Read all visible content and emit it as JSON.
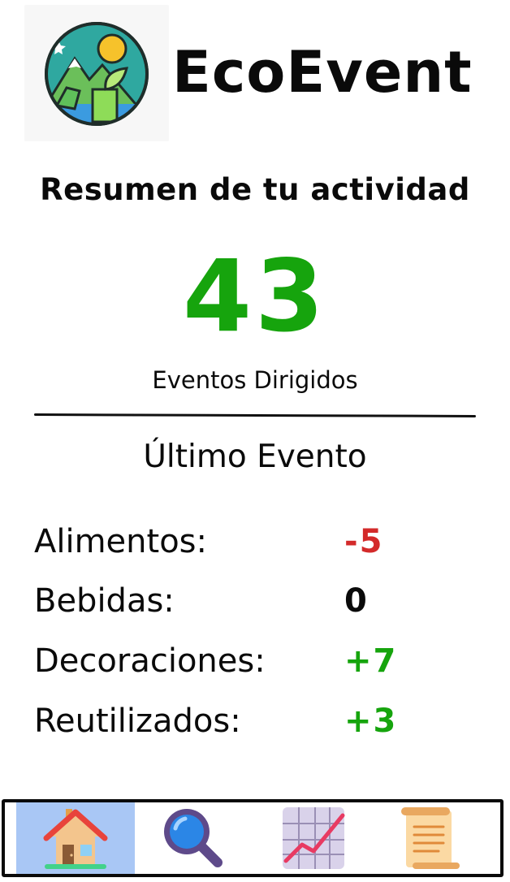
{
  "app": {
    "name": "EcoEvent",
    "logo_icon": "eco-landscape-logo"
  },
  "summary": {
    "title": "Resumen de tu actividad",
    "events_led_count": "43",
    "events_led_label": "Eventos Dirigidos",
    "count_color": "#16a40d"
  },
  "last_event": {
    "title": "Último Evento",
    "stats": [
      {
        "label": "Alimentos:",
        "value": "-5",
        "color": "#d32a2a"
      },
      {
        "label": "Bebidas:",
        "value": "0",
        "color": "#0a0a0a"
      },
      {
        "label": "Decoraciones:",
        "value": "+7",
        "color": "#16a40d"
      },
      {
        "label": "Reutilizados:",
        "value": "+3",
        "color": "#16a40d"
      }
    ]
  },
  "nav": {
    "items": [
      {
        "icon": "home-icon",
        "active": true
      },
      {
        "icon": "search-icon",
        "active": false
      },
      {
        "icon": "chart-icon",
        "active": false
      },
      {
        "icon": "scroll-icon",
        "active": false
      }
    ],
    "active_color": "#a9c7f5"
  }
}
